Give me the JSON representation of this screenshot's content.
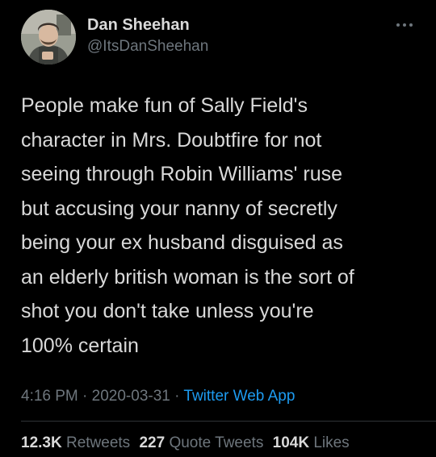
{
  "author": {
    "display_name": "Dan Sheehan",
    "handle": "@ItsDanSheehan",
    "avatar_icon": "profile-photo-avatar"
  },
  "menu": {
    "icon": "more-horizontal-icon"
  },
  "tweet": {
    "lines": [
      "People make fun of Sally Field's",
      "character in Mrs. Doubtfire for not",
      "seeing through Robin Williams' ruse",
      "but accusing your nanny of secretly",
      "being your ex husband disguised as",
      "an elderly british woman is the sort of",
      "shot you don't take unless you're",
      "100% certain"
    ]
  },
  "meta": {
    "time": "4:16 PM",
    "separator": "·",
    "date": "2020-03-31",
    "source": "Twitter Web App"
  },
  "stats": {
    "retweets_count": "12.3K",
    "retweets_label": "Retweets",
    "quotes_count": "227",
    "quotes_label": "Quote Tweets",
    "likes_count": "104K",
    "likes_label": "Likes"
  },
  "colors": {
    "background": "#000000",
    "primary_text": "#d9d9d9",
    "secondary_text": "#6e767d",
    "link": "#1d9bf0",
    "divider": "#2f3336"
  }
}
